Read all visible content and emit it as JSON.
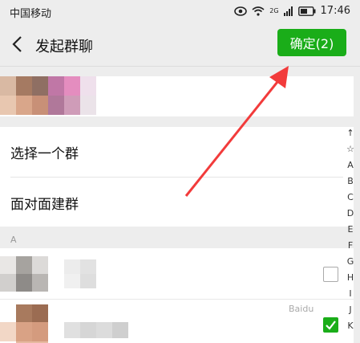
{
  "status_bar": {
    "carrier": "中国移动",
    "network": "2G",
    "time": "17:46"
  },
  "header": {
    "title": "发起群聊",
    "confirm_label": "确定(2)"
  },
  "menu": {
    "items": [
      {
        "label": "选择一个群"
      },
      {
        "label": "面对面建群"
      }
    ]
  },
  "section": {
    "letter": "A"
  },
  "index_bar": [
    "↑",
    "☆",
    "A",
    "B",
    "C",
    "D",
    "E",
    "F",
    "G",
    "H",
    "I",
    "J",
    "K"
  ],
  "contacts": [
    {
      "checked": false
    },
    {
      "checked": true
    }
  ],
  "watermark": "Baidu",
  "colors": {
    "accent": "#1aad19",
    "annotation_arrow": "#f23b3b"
  }
}
